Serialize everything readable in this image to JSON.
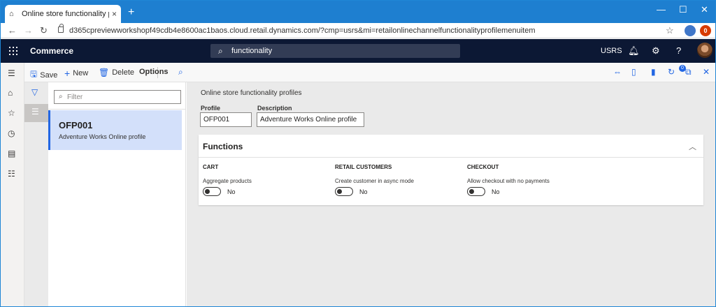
{
  "browser": {
    "tab_title": "Online store functionality profile",
    "tab_close": "×",
    "new_tab": "+",
    "minimize": "—",
    "maximize": "☐",
    "close": "✕",
    "url": "d365cpreviewworkshopf49cdb4e8600ac1baos.cloud.retail.dynamics.com/?cmp=usrs&mi=retailonlinechannelfunctionalityprofilemenuitem",
    "ext_badge": "0"
  },
  "topbar": {
    "app_name": "Commerce",
    "search_value": "functionality",
    "company": "USRS",
    "help": "?"
  },
  "actions": {
    "save": "Save",
    "new": "New",
    "delete": "Delete",
    "options": "Options",
    "notification_count": "0"
  },
  "list": {
    "filter_placeholder": "Filter",
    "items": [
      {
        "id": "OFP001",
        "description": "Adventure Works Online profile"
      }
    ]
  },
  "detail": {
    "caption": "Online store functionality profiles",
    "profile_label": "Profile",
    "profile_value": "OFP001",
    "description_label": "Description",
    "description_value": "Adventure Works Online profile"
  },
  "functions": {
    "title": "Functions",
    "groups": [
      {
        "title": "CART",
        "label": "Aggregate products",
        "value": "No"
      },
      {
        "title": "RETAIL CUSTOMERS",
        "label": "Create customer in async mode",
        "value": "No"
      },
      {
        "title": "CHECKOUT",
        "label": "Allow checkout with no payments",
        "value": "No"
      }
    ]
  },
  "colors": {
    "browser_accent": "#1e7fd0",
    "appbar": "#0c1834",
    "accent": "#2266e3",
    "selected_row": "#d3e0fa"
  }
}
